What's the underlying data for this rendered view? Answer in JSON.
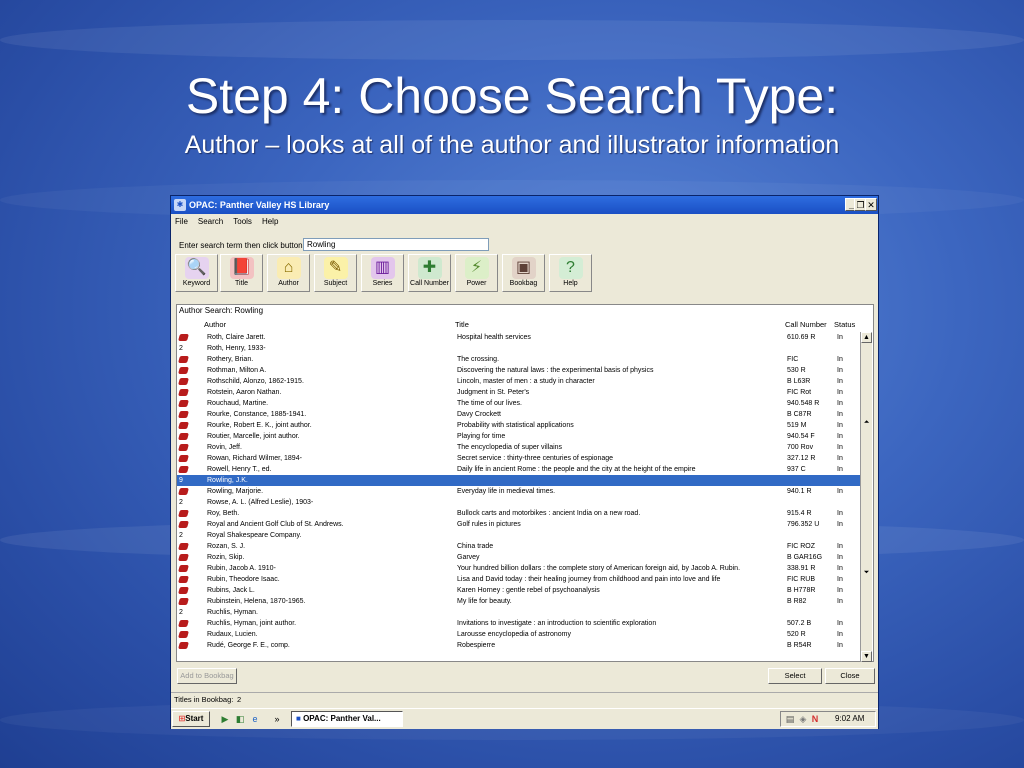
{
  "slide": {
    "title": "Step 4: Choose Search Type:",
    "subtitle": "Author – looks at all of the author and illustrator information"
  },
  "window": {
    "title": "OPAC: Panther Valley HS Library",
    "controls": {
      "minimize": "_",
      "restore": "❐",
      "close": "✕"
    }
  },
  "menu": {
    "items": [
      "File",
      "Search",
      "Tools",
      "Help"
    ]
  },
  "search": {
    "prompt": "Enter search term then click button:",
    "value": "Rowling"
  },
  "toolbar": {
    "buttons": [
      {
        "label": "Keyword",
        "icon": "magnifier-icon",
        "color": "#c9a0dc"
      },
      {
        "label": "Title",
        "icon": "book-title-icon",
        "color": "#d32f2f"
      },
      {
        "label": "Author",
        "icon": "house-icon",
        "color": "#f2c84b"
      },
      {
        "label": "Subject",
        "icon": "subject-tags-icon",
        "color": "#f5d742"
      },
      {
        "label": "Series",
        "icon": "books-series-icon",
        "color": "#8e24aa"
      },
      {
        "label": "Call Number",
        "icon": "call-number-icon",
        "color": "#43a047"
      },
      {
        "label": "Power",
        "icon": "power-search-icon",
        "color": "#7cb342"
      },
      {
        "label": "Bookbag",
        "icon": "bookbag-icon",
        "color": "#6d4c41"
      },
      {
        "label": "Help",
        "icon": "help-icon",
        "color": "#66bb6a"
      }
    ]
  },
  "results": {
    "caption": "Author Search: Rowling",
    "columns": {
      "author": "Author",
      "title": "Title",
      "call_number": "Call Number",
      "status": "Status"
    },
    "rows": [
      {
        "count": "",
        "author": "Roth, Claire Jarett.",
        "title": "Hospital health services",
        "call": "610.69 R",
        "status": "In"
      },
      {
        "count": "2",
        "author": "Roth, Henry, 1933-",
        "title": "",
        "call": "",
        "status": ""
      },
      {
        "count": "",
        "author": "Rothery, Brian.",
        "title": "The crossing.",
        "call": "FIC",
        "status": "In"
      },
      {
        "count": "",
        "author": "Rothman, Milton A.",
        "title": "Discovering the natural laws : the experimental basis of physics",
        "call": "530 R",
        "status": "In"
      },
      {
        "count": "",
        "author": "Rothschild, Alonzo, 1862-1915.",
        "title": "Lincoln, master of men : a study in character",
        "call": "B L63R",
        "status": "In"
      },
      {
        "count": "",
        "author": "Rotstein, Aaron Nathan.",
        "title": "Judgment in St. Peter's",
        "call": "FIC Rot",
        "status": "In"
      },
      {
        "count": "",
        "author": "Rouchaud, Martine.",
        "title": "The time of our lives.",
        "call": "940.548 R",
        "status": "In"
      },
      {
        "count": "",
        "author": "Rourke, Constance, 1885-1941.",
        "title": "Davy Crockett",
        "call": "B C87R",
        "status": "In"
      },
      {
        "count": "",
        "author": "Rourke, Robert E. K., joint author.",
        "title": "Probability with statistical applications",
        "call": "519 M",
        "status": "In"
      },
      {
        "count": "",
        "author": "Routier, Marcelle, joint author.",
        "title": "Playing for time",
        "call": "940.54 F",
        "status": "In"
      },
      {
        "count": "",
        "author": "Rovin, Jeff.",
        "title": "The encyclopedia of super villains",
        "call": "700 Rov",
        "status": "In"
      },
      {
        "count": "",
        "author": "Rowan, Richard Wilmer, 1894-",
        "title": "Secret service : thirty-three centuries of espionage",
        "call": "327.12 R",
        "status": "In"
      },
      {
        "count": "",
        "author": "Rowell, Henry T., ed.",
        "title": "Daily life in ancient Rome : the people and the city at the height of the empire",
        "call": "937 C",
        "status": "In"
      },
      {
        "count": "9",
        "author": "Rowling, J.K.",
        "title": "",
        "call": "",
        "status": "",
        "selected": true
      },
      {
        "count": "",
        "author": "Rowling, Marjorie.",
        "title": "Everyday life in medieval times.",
        "call": "940.1 R",
        "status": "In"
      },
      {
        "count": "2",
        "author": "Rowse, A. L. (Alfred Leslie), 1903-",
        "title": "",
        "call": "",
        "status": ""
      },
      {
        "count": "",
        "author": "Roy, Beth.",
        "title": "Bullock carts and motorbikes : ancient India on a new road.",
        "call": "915.4 R",
        "status": "In"
      },
      {
        "count": "",
        "author": "Royal and Ancient Golf Club of St. Andrews.",
        "title": "Golf rules in pictures",
        "call": "796.352 U",
        "status": "In"
      },
      {
        "count": "2",
        "author": "Royal Shakespeare Company.",
        "title": "",
        "call": "",
        "status": ""
      },
      {
        "count": "",
        "author": "Rozan, S. J.",
        "title": "China trade",
        "call": "FIC ROZ",
        "status": "In"
      },
      {
        "count": "",
        "author": "Rozin, Skip.",
        "title": "Garvey",
        "call": "B GAR16G",
        "status": "In"
      },
      {
        "count": "",
        "author": "Rubin, Jacob A. 1910-",
        "title": "Your hundred billion dollars : the complete story of American foreign aid, by Jacob A. Rubin.",
        "call": "338.91 R",
        "status": "In"
      },
      {
        "count": "",
        "author": "Rubin, Theodore Isaac.",
        "title": "Lisa and David today : their healing journey from childhood and pain into love and life",
        "call": "FIC RUB",
        "status": "In"
      },
      {
        "count": "",
        "author": "Rubins, Jack L.",
        "title": "Karen Horney : gentle rebel of psychoanalysis",
        "call": "B H778R",
        "status": "In"
      },
      {
        "count": "",
        "author": "Rubinstein, Helena, 1870-1965.",
        "title": "My life for beauty.",
        "call": "B R82",
        "status": "In"
      },
      {
        "count": "2",
        "author": "Ruchlis, Hyman.",
        "title": "",
        "call": "",
        "status": ""
      },
      {
        "count": "",
        "author": "Ruchlis, Hyman, joint author.",
        "title": "Invitations to investigate : an introduction to scientific exploration",
        "call": "507.2 B",
        "status": "In"
      },
      {
        "count": "",
        "author": "Rudaux, Lucien.",
        "title": "Larousse encyclopedia of astronomy",
        "call": "520 R",
        "status": "In"
      },
      {
        "count": "",
        "author": "Rudé, George F. E., comp.",
        "title": "Robespierre",
        "call": "B R54R",
        "status": "In"
      }
    ]
  },
  "buttons": {
    "add_to_bookbag": "Add to Bookbag",
    "select": "Select",
    "close": "Close"
  },
  "status_bar": {
    "bookbag_label": "Titles in Bookbag:",
    "bookbag_count": "2"
  },
  "taskbar": {
    "start": "Start",
    "overflow": "»",
    "task": "OPAC: Panther Val...",
    "clock": "9:02 AM"
  }
}
